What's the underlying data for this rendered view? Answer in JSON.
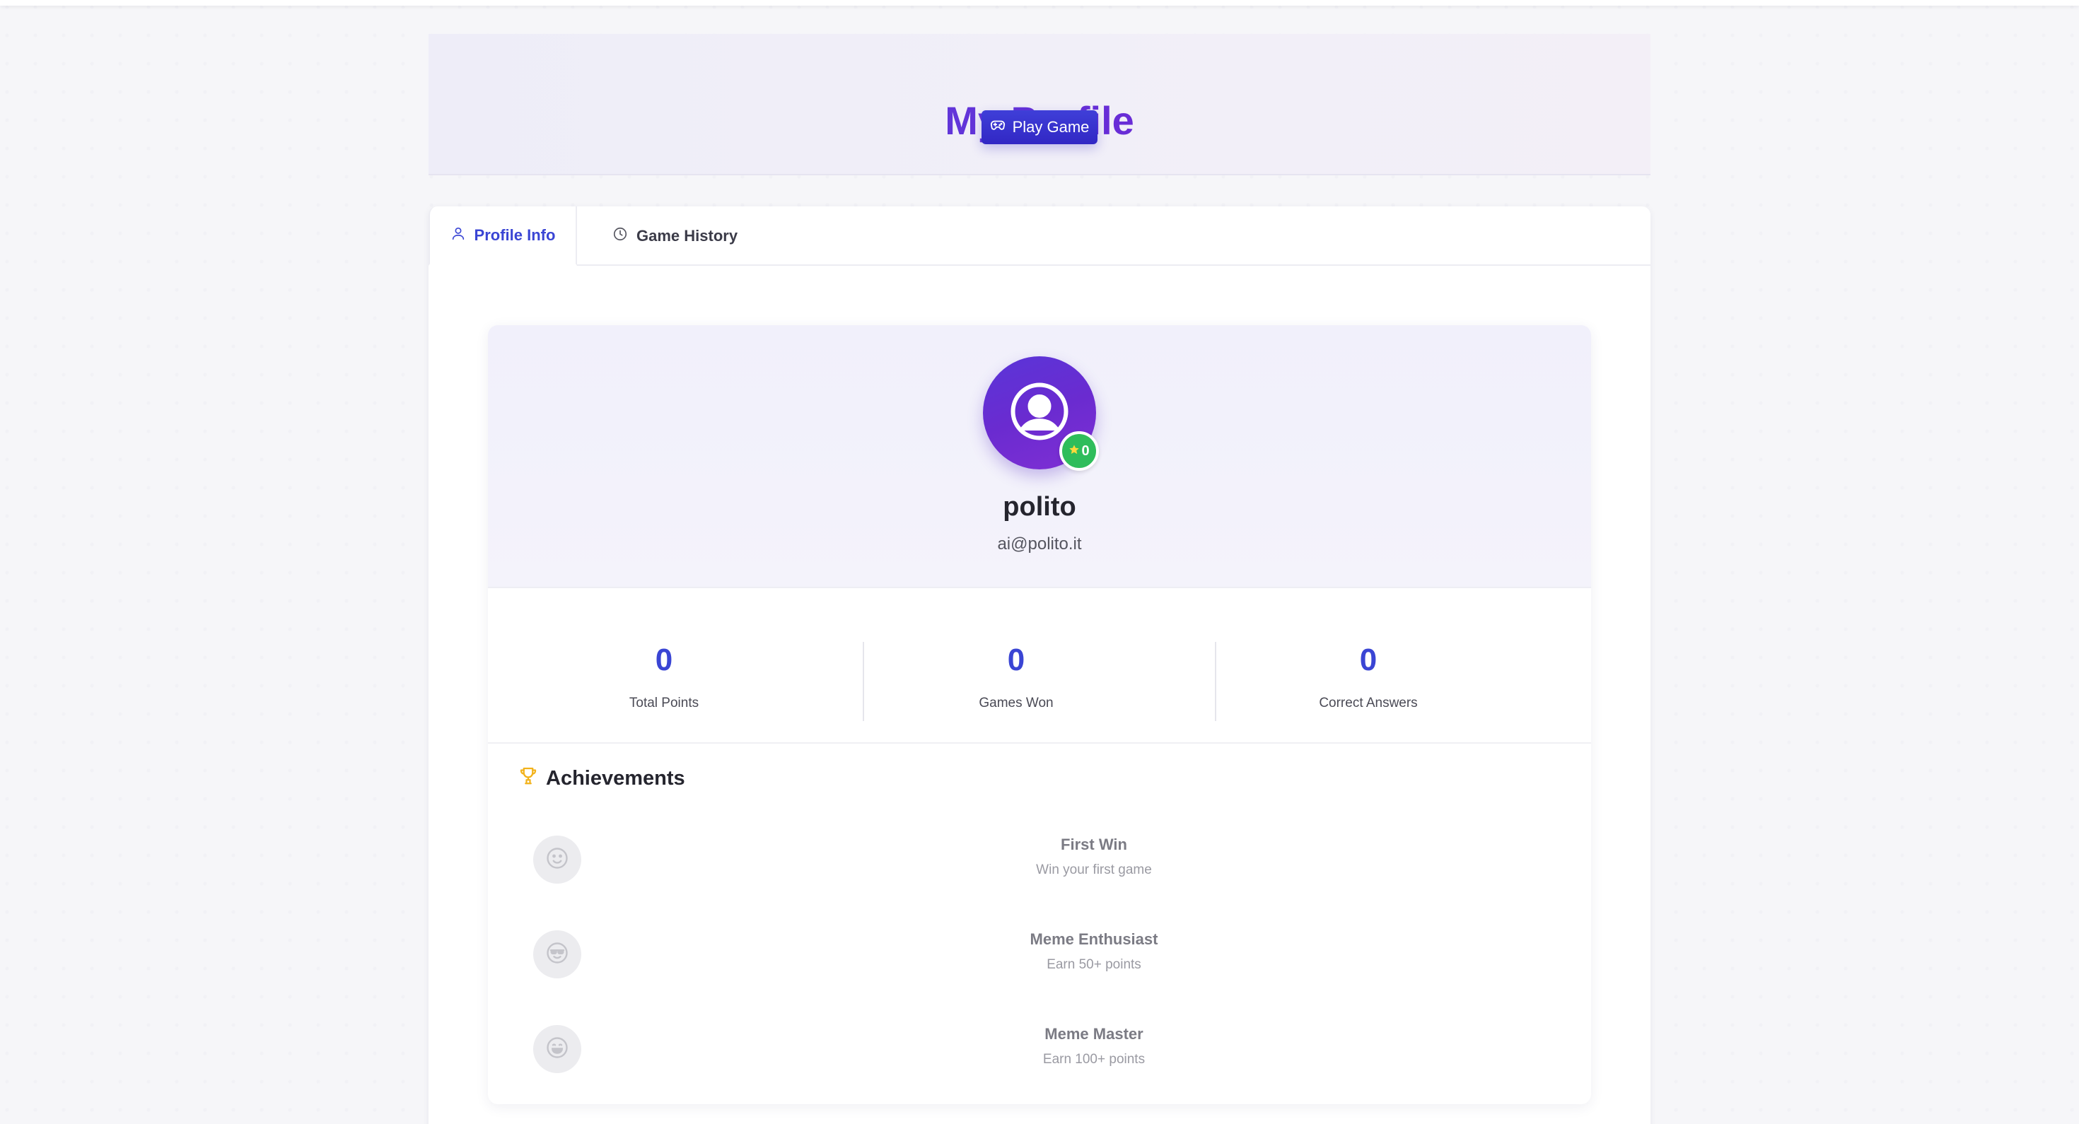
{
  "header": {
    "title": "My Profile",
    "play_button_label": "Play Game"
  },
  "tabs": [
    {
      "label": "Profile Info",
      "active": true,
      "icon": "user-icon"
    },
    {
      "label": "Game History",
      "active": false,
      "icon": "clock-icon"
    }
  ],
  "profile": {
    "username": "polito",
    "email": "ai@polito.it",
    "level": "0",
    "avatar_icon": "user-circle-icon"
  },
  "stats": [
    {
      "value": "0",
      "label": "Total Points"
    },
    {
      "value": "0",
      "label": "Games Won"
    },
    {
      "value": "0",
      "label": "Correct Answers"
    }
  ],
  "achievements": {
    "title": "Achievements",
    "icon": "trophy-icon",
    "items": [
      {
        "name": "First Win",
        "description": "Win your first game",
        "icon": "smile-icon",
        "unlocked": false
      },
      {
        "name": "Meme Enthusiast",
        "description": "Earn 50+ points",
        "icon": "sunglasses-icon",
        "unlocked": false
      },
      {
        "name": "Meme Master",
        "description": "Earn 100+ points",
        "icon": "grin-icon",
        "unlocked": false
      }
    ]
  },
  "colors": {
    "accent": "#3a45d4",
    "title_gradient_start": "#4c4fe0",
    "title_gradient_end": "#7a1fc9",
    "level_badge": "#2fbd5b",
    "trophy": "#f2b21b"
  }
}
